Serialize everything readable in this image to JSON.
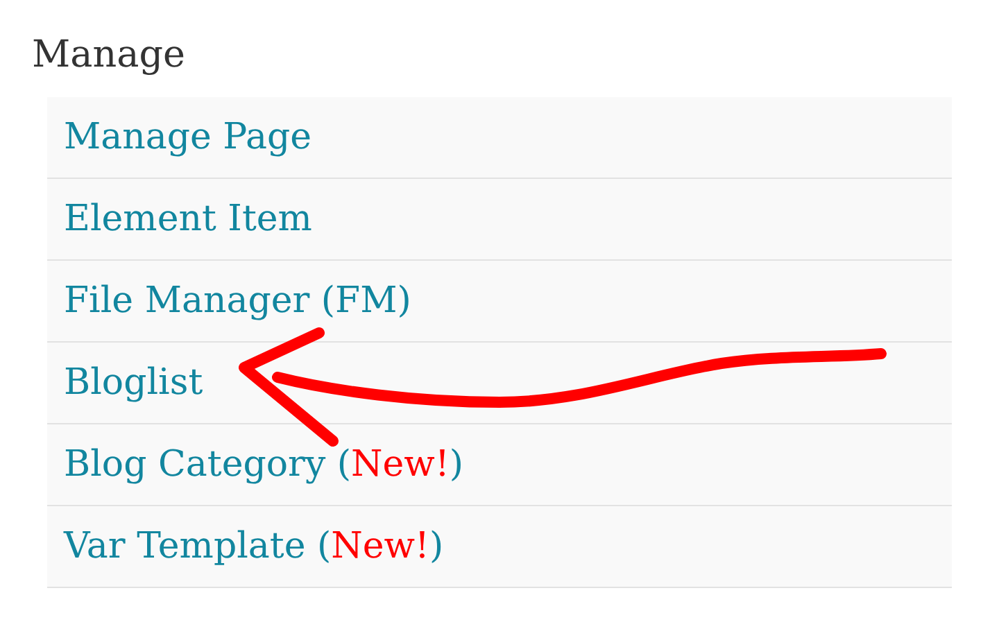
{
  "heading": "Manage",
  "items": [
    {
      "label": "Manage Page"
    },
    {
      "label": "Element Item"
    },
    {
      "label": "File Manager (FM)"
    },
    {
      "label": "Bloglist"
    },
    {
      "label": "Blog Category (",
      "badge": "New!",
      "label_end": ")"
    },
    {
      "label": "Var Template (",
      "badge": "New!",
      "label_end": ")"
    }
  ]
}
